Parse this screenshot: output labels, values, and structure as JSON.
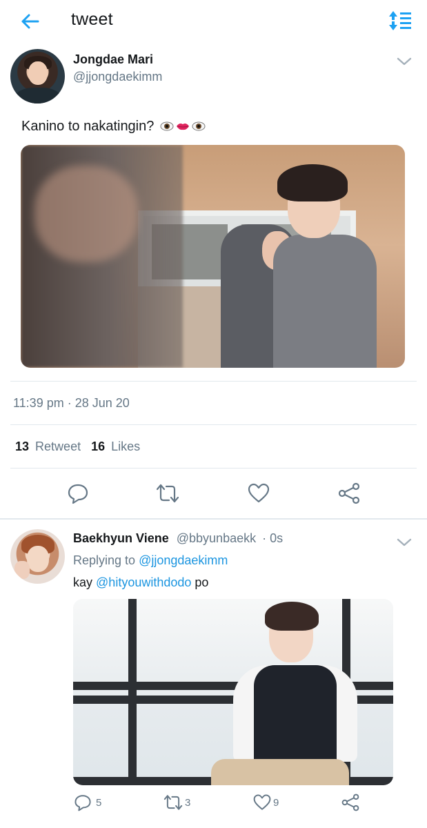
{
  "header": {
    "back_icon": "arrow-left-icon",
    "title": "tweet",
    "sort_icon": "sort-icon",
    "accent_color": "#1da1f2"
  },
  "tweet": {
    "author_name": "Jongdae Mari",
    "author_handle": "@jjongdaekimm",
    "text": "Kanino to nakatingin?",
    "emojis": [
      "eye-icon",
      "lips-icon",
      "eye-icon"
    ],
    "time": "11:39 pm · 28 Jun 20",
    "retweet_count": "13",
    "retweet_label": "Retweet",
    "likes_count": "16",
    "likes_label": "Likes",
    "actions": [
      "reply-icon",
      "retweet-icon",
      "like-icon",
      "share-icon"
    ]
  },
  "reply": {
    "author_name": "Baekhyun Viene",
    "author_handle": "@bbyunbaekk",
    "time": "· 0s",
    "replying_prefix": "Replying to",
    "replying_handle": "@jjongdaekimm",
    "text_prefix": "kay",
    "mention": "@hityouwithdodo",
    "text_suffix": "po",
    "reply_count": "5",
    "retweet_count": "3",
    "like_count": "9"
  }
}
